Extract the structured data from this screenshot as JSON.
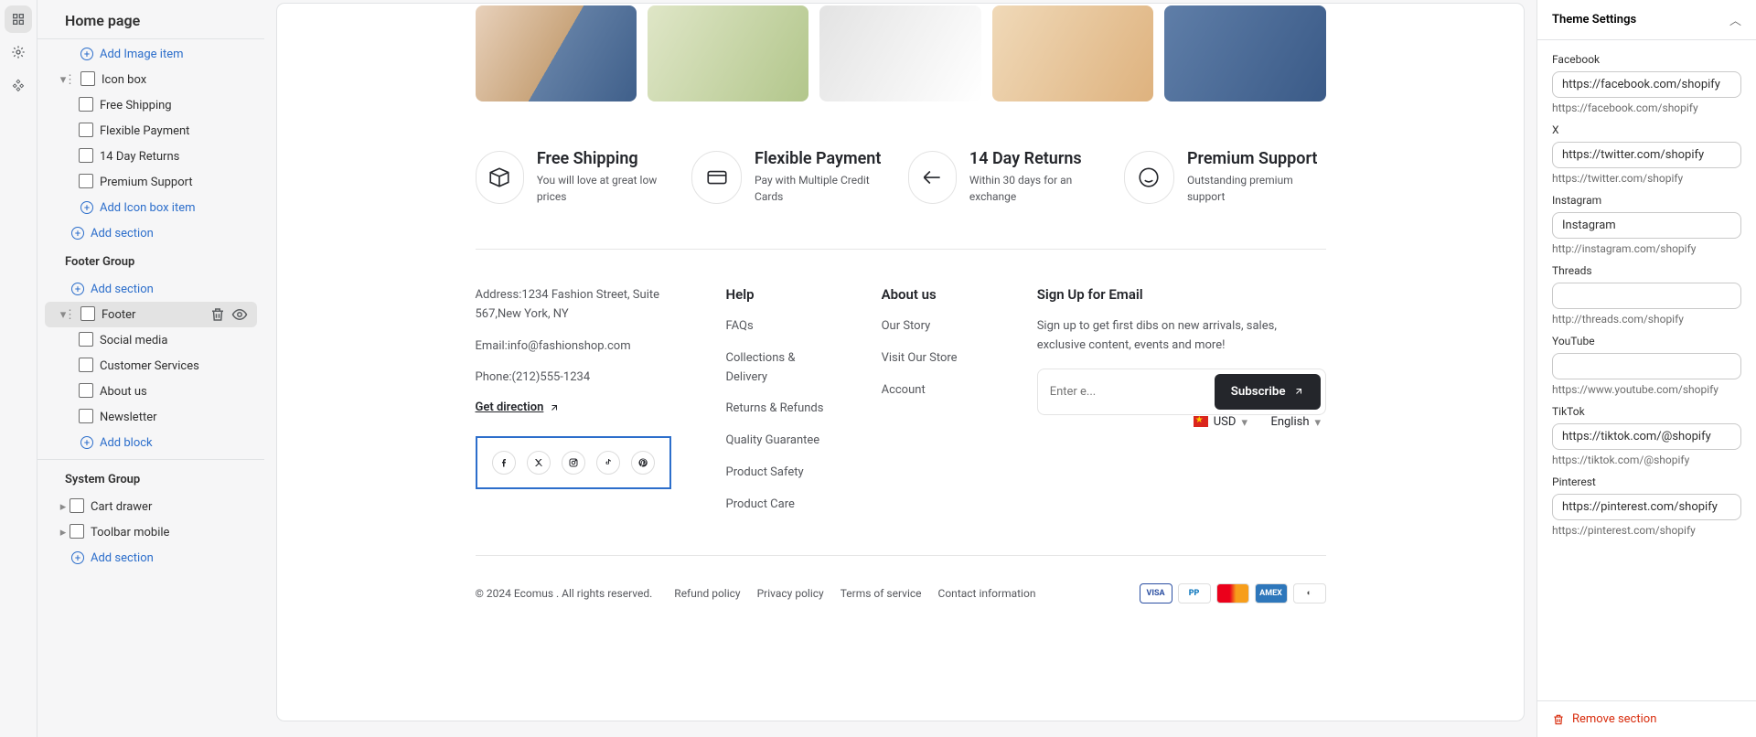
{
  "sidebar": {
    "title": "Home page",
    "iconBox": {
      "label": "Icon box",
      "addImage": "Add Image item",
      "children": [
        "Free Shipping",
        "Flexible Payment",
        "14 Day Returns",
        "Premium Support"
      ],
      "addItem": "Add Icon box item",
      "addSection": "Add section"
    },
    "footerGroup": {
      "header": "Footer Group",
      "addSection": "Add section",
      "footer": "Footer",
      "children": [
        "Social media",
        "Customer Services",
        "About us",
        "Newsletter"
      ],
      "addBlock": "Add block"
    },
    "systemGroup": {
      "header": "System Group",
      "items": [
        "Cart drawer",
        "Toolbar mobile"
      ],
      "addSection": "Add section"
    }
  },
  "preview": {
    "iconBoxes": [
      {
        "title": "Free Shipping",
        "desc": "You will love at great low prices"
      },
      {
        "title": "Flexible Payment",
        "desc": "Pay with Multiple Credit Cards"
      },
      {
        "title": "14 Day Returns",
        "desc": "Within 30 days for an exchange"
      },
      {
        "title": "Premium Support",
        "desc": "Outstanding premium support"
      }
    ],
    "footer": {
      "address": {
        "line1": "Address:1234 Fashion Street, Suite 567,New York, NY",
        "line2": "Email:info@fashionshop.com",
        "line3": "Phone:(212)555-1234",
        "direction": "Get direction"
      },
      "help": {
        "title": "Help",
        "items": [
          "FAQs",
          "Collections & Delivery",
          "Returns & Refunds",
          "Quality Guarantee",
          "Product Safety",
          "Product Care"
        ]
      },
      "about": {
        "title": "About us",
        "items": [
          "Our Story",
          "Visit Our Store",
          "Account"
        ]
      },
      "news": {
        "title": "Sign Up for Email",
        "desc": "Sign up to get first dibs on new arrivals, sales, exclusive content, events and more!",
        "placeholder": "Enter e...",
        "subscribe": "Subscribe"
      }
    },
    "selectors": {
      "currency": "USD",
      "language": "English"
    },
    "bottom": {
      "copyright": "© 2024 Ecomus . All rights reserved.",
      "links": [
        "Refund policy",
        "Privacy policy",
        "Terms of service",
        "Contact information"
      ]
    }
  },
  "rightPanel": {
    "title": "Theme Settings",
    "fields": [
      {
        "key": "fb",
        "label": "Facebook",
        "value": "https://facebook.com/shopify",
        "hint": "https://facebook.com/shopify"
      },
      {
        "key": "x",
        "label": "X",
        "value": "https://twitter.com/shopify",
        "hint": "https://twitter.com/shopify"
      },
      {
        "key": "ig",
        "label": "Instagram",
        "value": "Instagram",
        "hint": "http://instagram.com/shopify"
      },
      {
        "key": "th",
        "label": "Threads",
        "value": "",
        "hint": "http://threads.com/shopify"
      },
      {
        "key": "yt",
        "label": "YouTube",
        "value": "",
        "hint": "https://www.youtube.com/shopify"
      },
      {
        "key": "tt",
        "label": "TikTok",
        "value": "https://tiktok.com/@shopify",
        "hint": "https://tiktok.com/@shopify"
      },
      {
        "key": "pin",
        "label": "Pinterest",
        "value": "https://pinterest.com/shopify",
        "hint": "https://pinterest.com/shopify"
      }
    ],
    "remove": "Remove section"
  }
}
